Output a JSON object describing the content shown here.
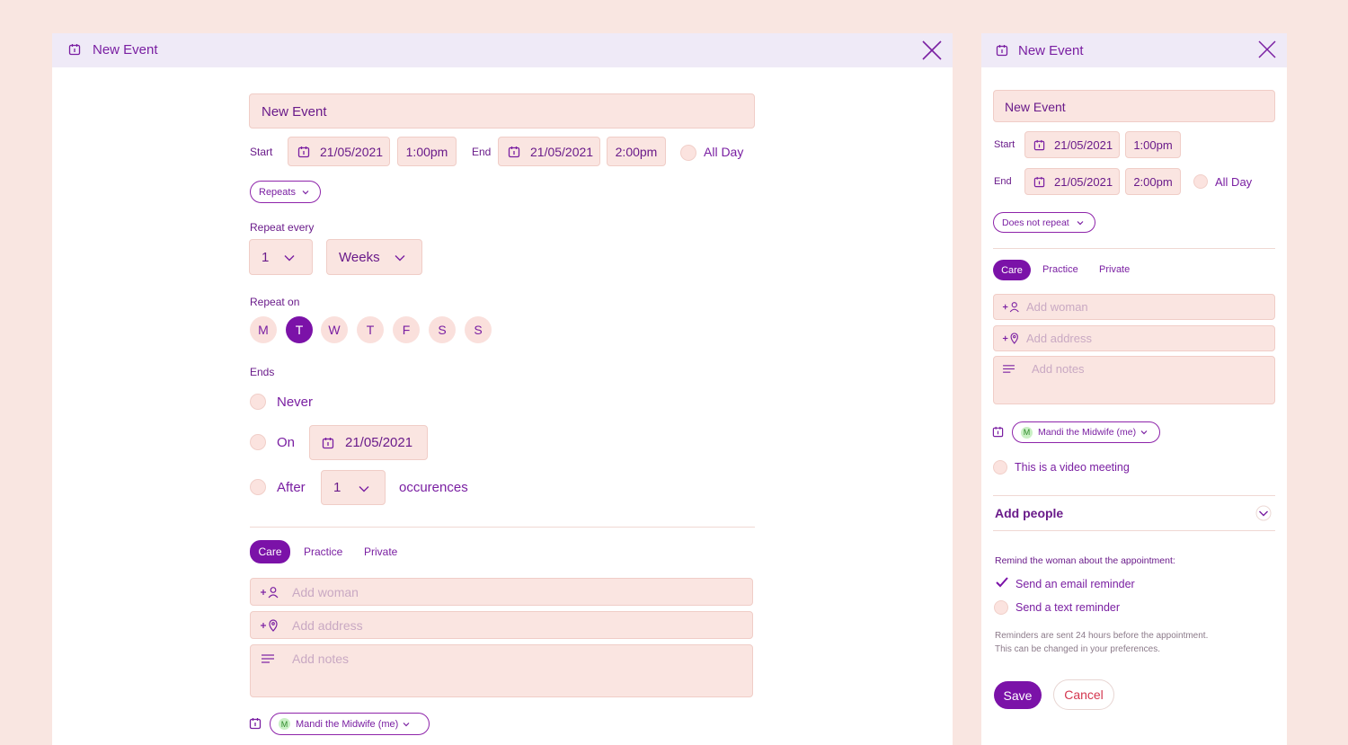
{
  "colors": {
    "background": "#f9e6e1",
    "accent": "#7b12a8",
    "field": "#fae5e1",
    "titlebar": "#efeaf7",
    "cancel_text": "#d4364f"
  },
  "left_panel": {
    "title": "New Event",
    "event_name": "New Event",
    "start_label": "Start",
    "start_date": "21/05/2021",
    "start_time": "1:00pm",
    "end_label": "End",
    "end_date": "21/05/2021",
    "end_time": "2:00pm",
    "all_day_label": "All Day",
    "repeats_label": "Repeats",
    "repeat_every_label": "Repeat every",
    "repeat_every_value": "1",
    "repeat_every_unit": "Weeks",
    "repeat_on_label": "Repeat on",
    "days": [
      {
        "label": "M",
        "selected": false
      },
      {
        "label": "T",
        "selected": true
      },
      {
        "label": "W",
        "selected": false
      },
      {
        "label": "T",
        "selected": false
      },
      {
        "label": "F",
        "selected": false
      },
      {
        "label": "S",
        "selected": false
      },
      {
        "label": "S",
        "selected": false
      }
    ],
    "ends_label": "Ends",
    "ends_never_label": "Never",
    "ends_on_label": "On",
    "ends_on_date": "21/05/2021",
    "ends_after_label": "After",
    "ends_after_value": "1",
    "occurrences_label": "occurences",
    "tabs": [
      "Care",
      "Practice",
      "Private"
    ],
    "add_woman_placeholder": "Add woman",
    "add_address_placeholder": "Add address",
    "add_notes_placeholder": "Add notes",
    "owner_initial": "M",
    "owner_name": "Mandi the Midwife (me)"
  },
  "right_panel": {
    "title": "New Event",
    "event_name": "New Event",
    "start_label": "Start",
    "start_date": "21/05/2021",
    "start_time": "1:00pm",
    "end_label": "End",
    "end_date": "21/05/2021",
    "end_time": "2:00pm",
    "all_day_label": "All Day",
    "repeat_label": "Does not repeat",
    "tabs": [
      "Care",
      "Practice",
      "Private"
    ],
    "add_woman_placeholder": "Add woman",
    "add_address_placeholder": "Add address",
    "add_notes_placeholder": "Add notes",
    "owner_initial": "M",
    "owner_name": "Mandi the Midwife (me)",
    "video_meeting_label": "This is a video meeting",
    "add_people_label": "Add people",
    "remind_heading": "Remind the woman about the appointment:",
    "email_reminder_label": "Send an email reminder",
    "email_reminder_checked": true,
    "text_reminder_label": "Send a text reminder",
    "text_reminder_checked": false,
    "reminder_note_line1": "Reminders are sent 24 hours before the appointment.",
    "reminder_note_line2": "This can be changed in your preferences.",
    "save_label": "Save",
    "cancel_label": "Cancel"
  }
}
